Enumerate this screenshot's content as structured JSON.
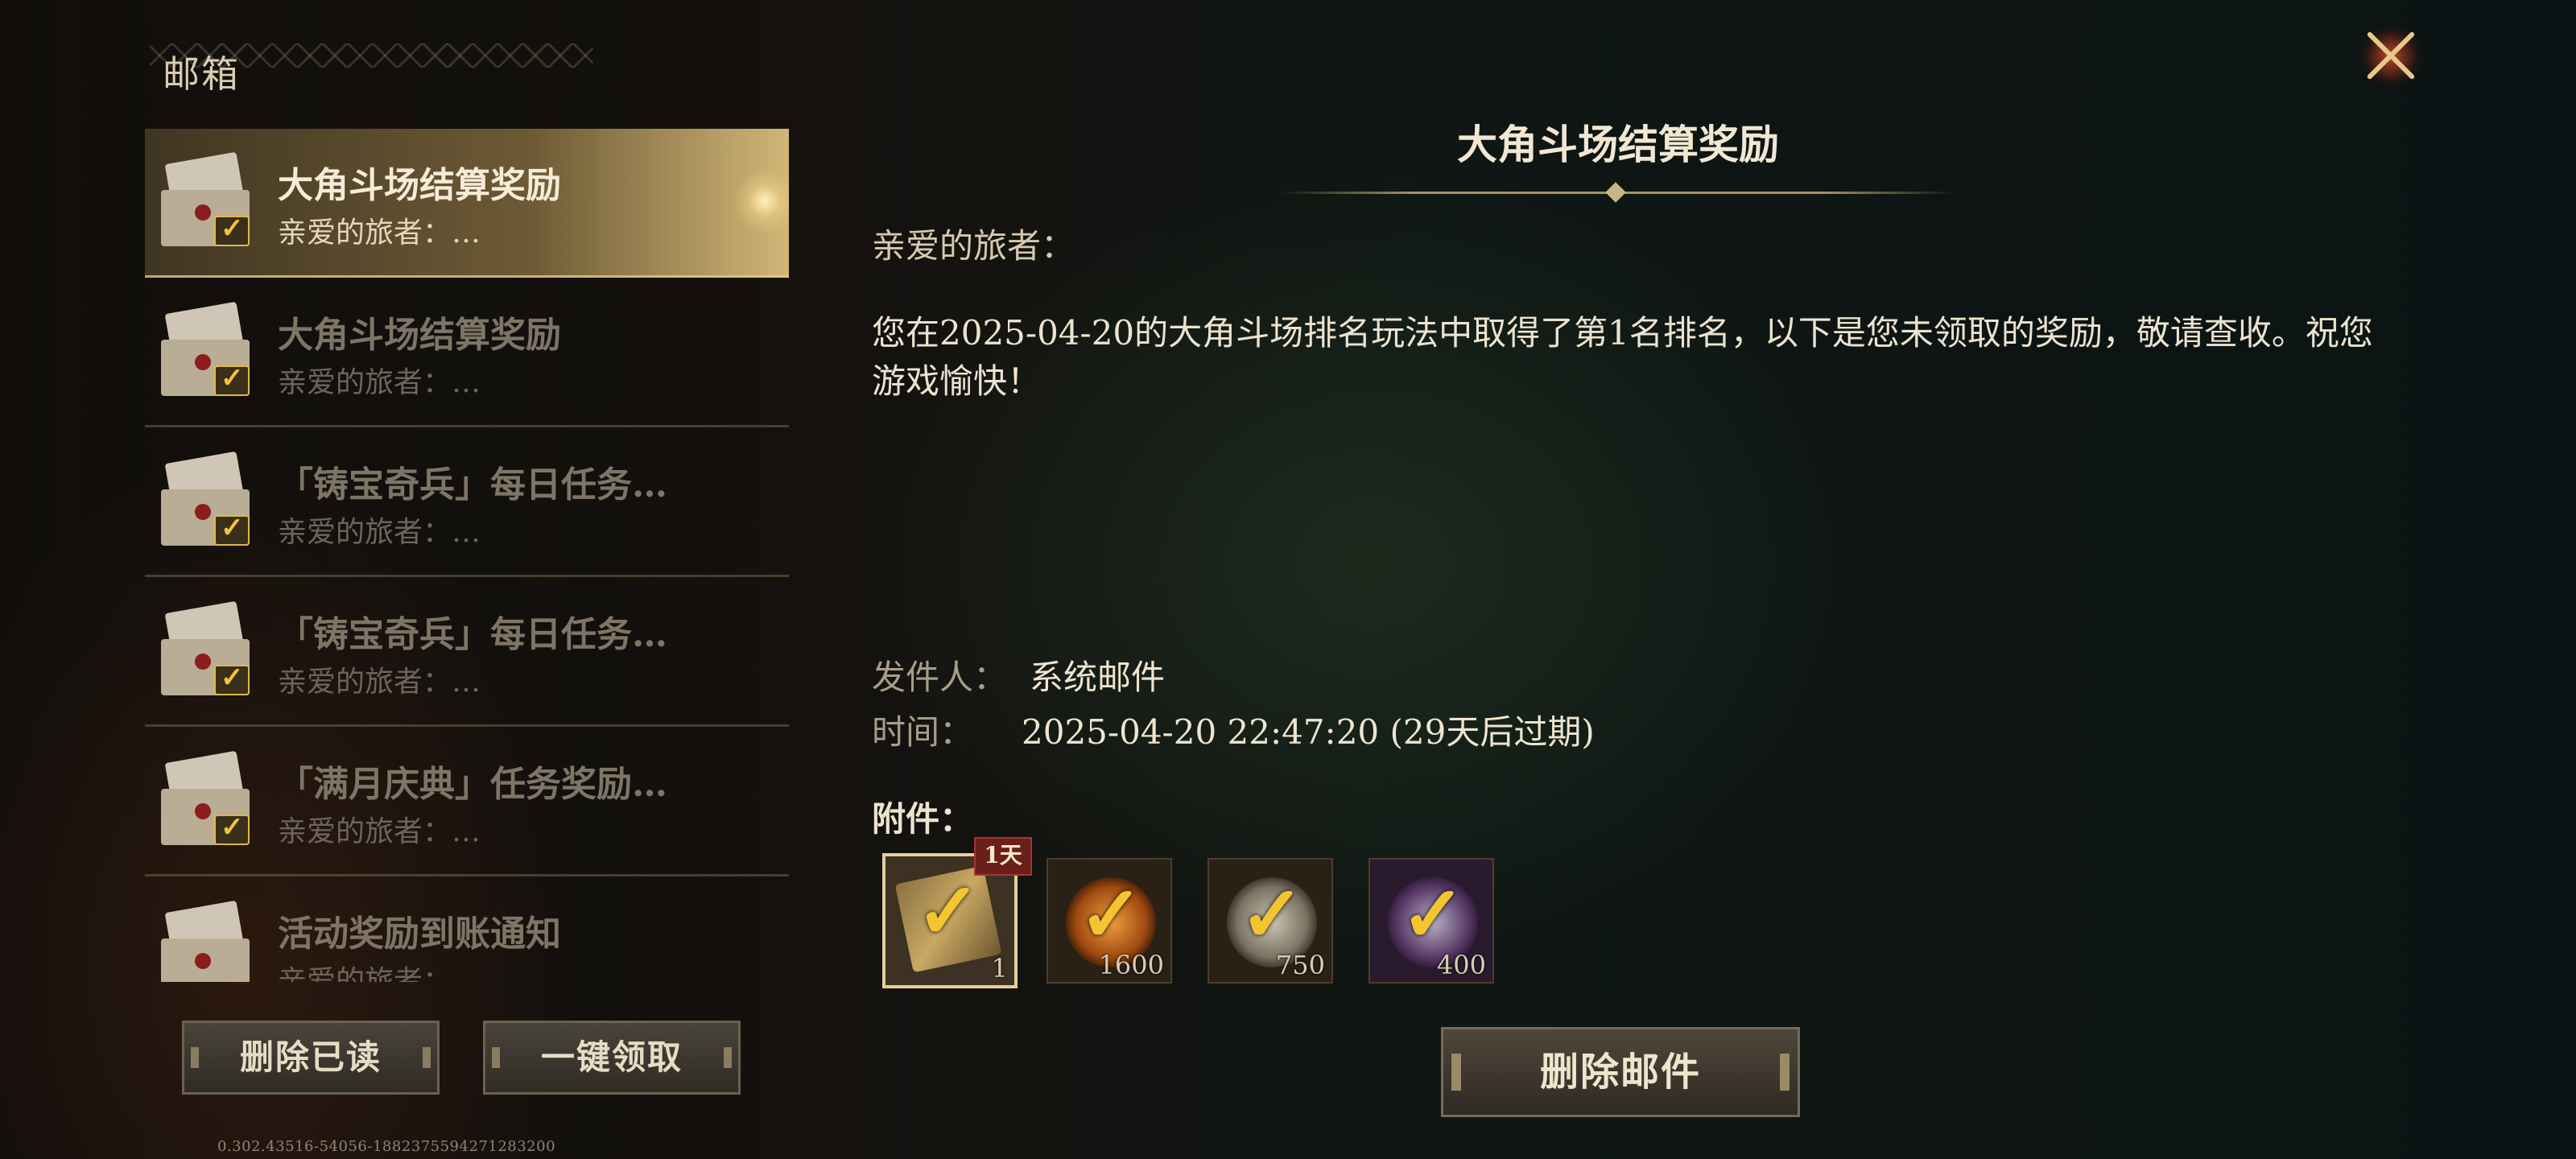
{
  "header": {
    "title": "邮箱"
  },
  "mail_list": [
    {
      "title": "大角斗场结算奖励",
      "preview": "亲爱的旅者：…",
      "selected": true
    },
    {
      "title": "大角斗场结算奖励",
      "preview": "亲爱的旅者：…",
      "selected": false
    },
    {
      "title": "「铸宝奇兵」每日任务…",
      "preview": "亲爱的旅者：…",
      "selected": false
    },
    {
      "title": "「铸宝奇兵」每日任务…",
      "preview": "亲爱的旅者：…",
      "selected": false
    },
    {
      "title": "「满月庆典」任务奖励…",
      "preview": "亲爱的旅者：…",
      "selected": false
    },
    {
      "title": "活动奖励到账通知",
      "preview": "亲爱的旅者：…",
      "selected": false
    }
  ],
  "buttons": {
    "delete_read": "删除已读",
    "claim_all": "一键领取",
    "delete_mail": "删除邮件"
  },
  "version": "0.302.43516-54056-18823755942712832​00",
  "detail": {
    "title": "大角斗场结算奖励",
    "greeting": "亲爱的旅者：",
    "body": "您在2025-04-20的大角斗场排名玩法中取得了第1名排名，以下是您未领取的奖励，敬请查收。祝您游戏愉快！",
    "sender_label": "发件人：",
    "sender": "系统邮件",
    "time_label": "时间：",
    "time": "2025-04-20 22:47:20 (29天后过期)",
    "attachments_label": "附件：",
    "attachments": [
      {
        "qty": "1",
        "badge": "1天",
        "icon": "card-scroll-icon",
        "color": "#b89a5a"
      },
      {
        "qty": "1600",
        "icon": "fire-orb-icon",
        "color": "#d9782b"
      },
      {
        "qty": "750",
        "icon": "silver-star-icon",
        "color": "#9a9488"
      },
      {
        "qty": "400",
        "icon": "purple-emblem-icon",
        "color": "#5a3a6a"
      }
    ]
  },
  "colors": {
    "accent_gold": "#e6cf98",
    "check": "#f4c530"
  }
}
